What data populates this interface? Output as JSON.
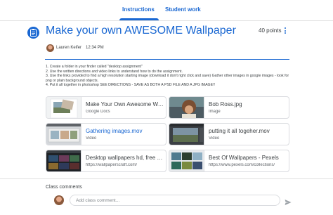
{
  "tabs": [
    {
      "label": "Instructions"
    },
    {
      "label": "Student work"
    }
  ],
  "assignment": {
    "title": "Make your own AWESOME Wallpaper",
    "points": "40 points",
    "author": "Lauren Keifer",
    "time": "12:34 PM",
    "icon": "assignment-icon"
  },
  "instructions": [
    "1. Create a folder in your finder called \"desktop assignment\"",
    "2. Use the written directions and video links to understand how to do the assignment.",
    "3. Use the links provided to find a high resolution starting image (download it don't right click and save) Gather other images in google images - look for png or plain background objects.",
    "4. Put it all together in photoshop SEE DIRECTIONS - SAVE AS BOTH A PSD FILE AND A JPG IMAGE!!"
  ],
  "attachments": [
    {
      "title": "Make Your Own Awesome Wallpaper",
      "type": "Google Docs"
    },
    {
      "title": "Bob Ross.jpg",
      "type": "Image"
    },
    {
      "title": "Gathering images.mov",
      "type": "Video"
    },
    {
      "title": "putting it all togeher.mov",
      "type": "Video"
    },
    {
      "title": "Desktop wallpapers hd, free deskt",
      "type": "https://wallpaperscraft.com/"
    },
    {
      "title": "Best Of Wallpapers - Pexels",
      "type": "https://www.pexels.com/collections/"
    }
  ],
  "comments": {
    "label": "Class comments",
    "placeholder": "Add class comment..."
  },
  "colors": {
    "accent": "#1967d2",
    "border": "#dadce0",
    "text": "#3c4043"
  }
}
